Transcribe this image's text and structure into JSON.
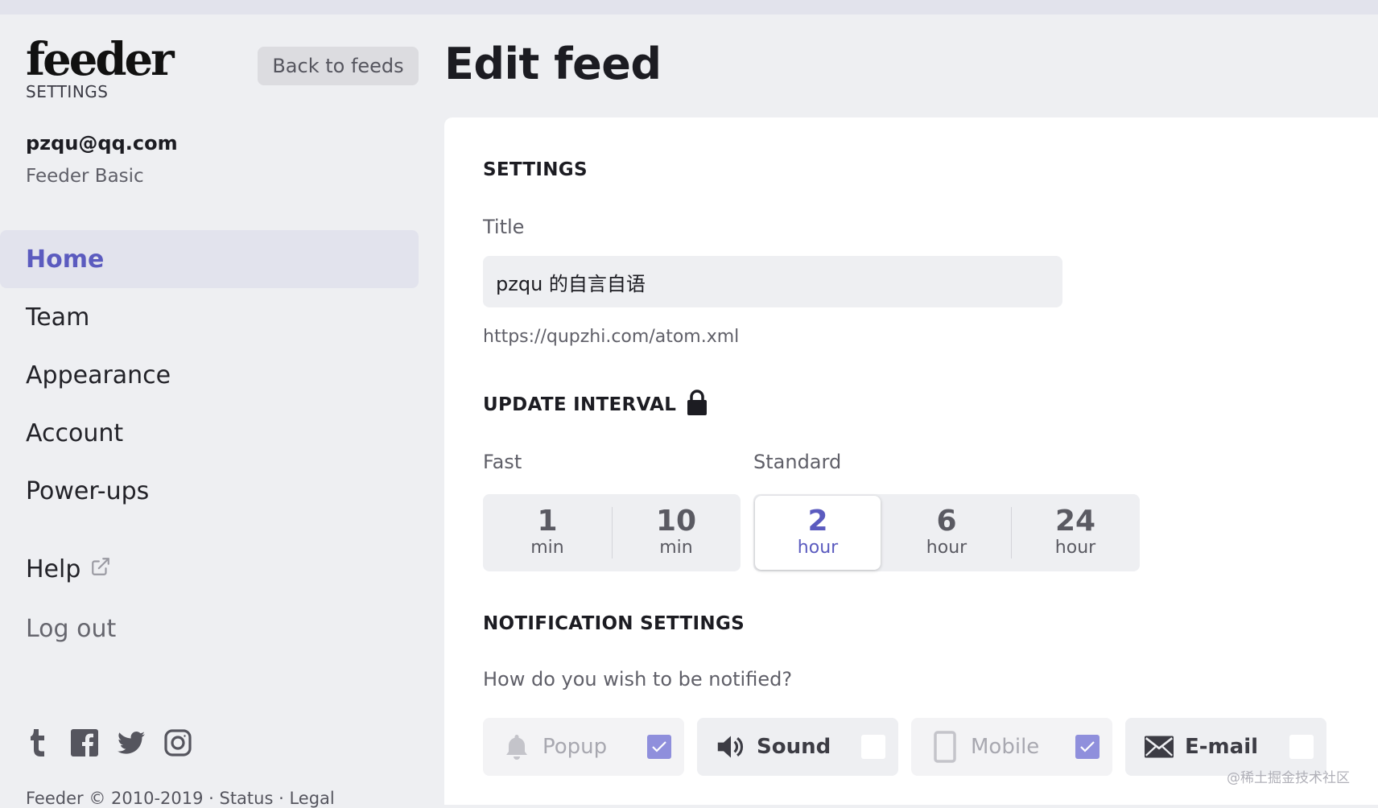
{
  "logo": {
    "text": "feeder",
    "subtitle": "SETTINGS"
  },
  "back_button": "Back to feeds",
  "user": {
    "email": "pzqu@qq.com",
    "plan": "Feeder Basic"
  },
  "nav": {
    "items": [
      {
        "label": "Home",
        "active": true
      },
      {
        "label": "Team",
        "active": false
      },
      {
        "label": "Appearance",
        "active": false
      },
      {
        "label": "Account",
        "active": false
      },
      {
        "label": "Power-ups",
        "active": false
      }
    ],
    "help": "Help",
    "logout": "Log out"
  },
  "social_icons": [
    "tumblr-icon",
    "facebook-icon",
    "twitter-icon",
    "instagram-icon"
  ],
  "footer": "Feeder © 2010-2019 · Status · Legal",
  "page_title": "Edit feed",
  "settings": {
    "heading": "SETTINGS",
    "title_label": "Title",
    "title_value": "pzqu 的自言自语",
    "feed_url": "https://qupzhi.com/atom.xml"
  },
  "update_interval": {
    "heading": "UPDATE INTERVAL",
    "locked": true,
    "fast_label": "Fast",
    "standard_label": "Standard",
    "options": [
      {
        "value": "1",
        "unit": "min"
      },
      {
        "value": "10",
        "unit": "min"
      },
      {
        "value": "2",
        "unit": "hour",
        "selected": true
      },
      {
        "value": "6",
        "unit": "hour"
      },
      {
        "value": "24",
        "unit": "hour"
      }
    ]
  },
  "notifications": {
    "heading": "NOTIFICATION SETTINGS",
    "question": "How do you wish to be notified?",
    "options": [
      {
        "label": "Popup",
        "icon": "bell-icon",
        "enabled": false,
        "checked": true
      },
      {
        "label": "Sound",
        "icon": "speaker-icon",
        "enabled": true,
        "checked": false
      },
      {
        "label": "Mobile",
        "icon": "mobile-icon",
        "enabled": false,
        "checked": true
      },
      {
        "label": "E-mail",
        "icon": "envelope-icon",
        "enabled": true,
        "checked": false
      }
    ]
  },
  "watermark": "@稀土掘金技术社区",
  "colors": {
    "accent": "#5b5bbf",
    "background": "#eeeff2",
    "card": "#ffffff",
    "checkbox_checked": "#8f8fdc"
  }
}
